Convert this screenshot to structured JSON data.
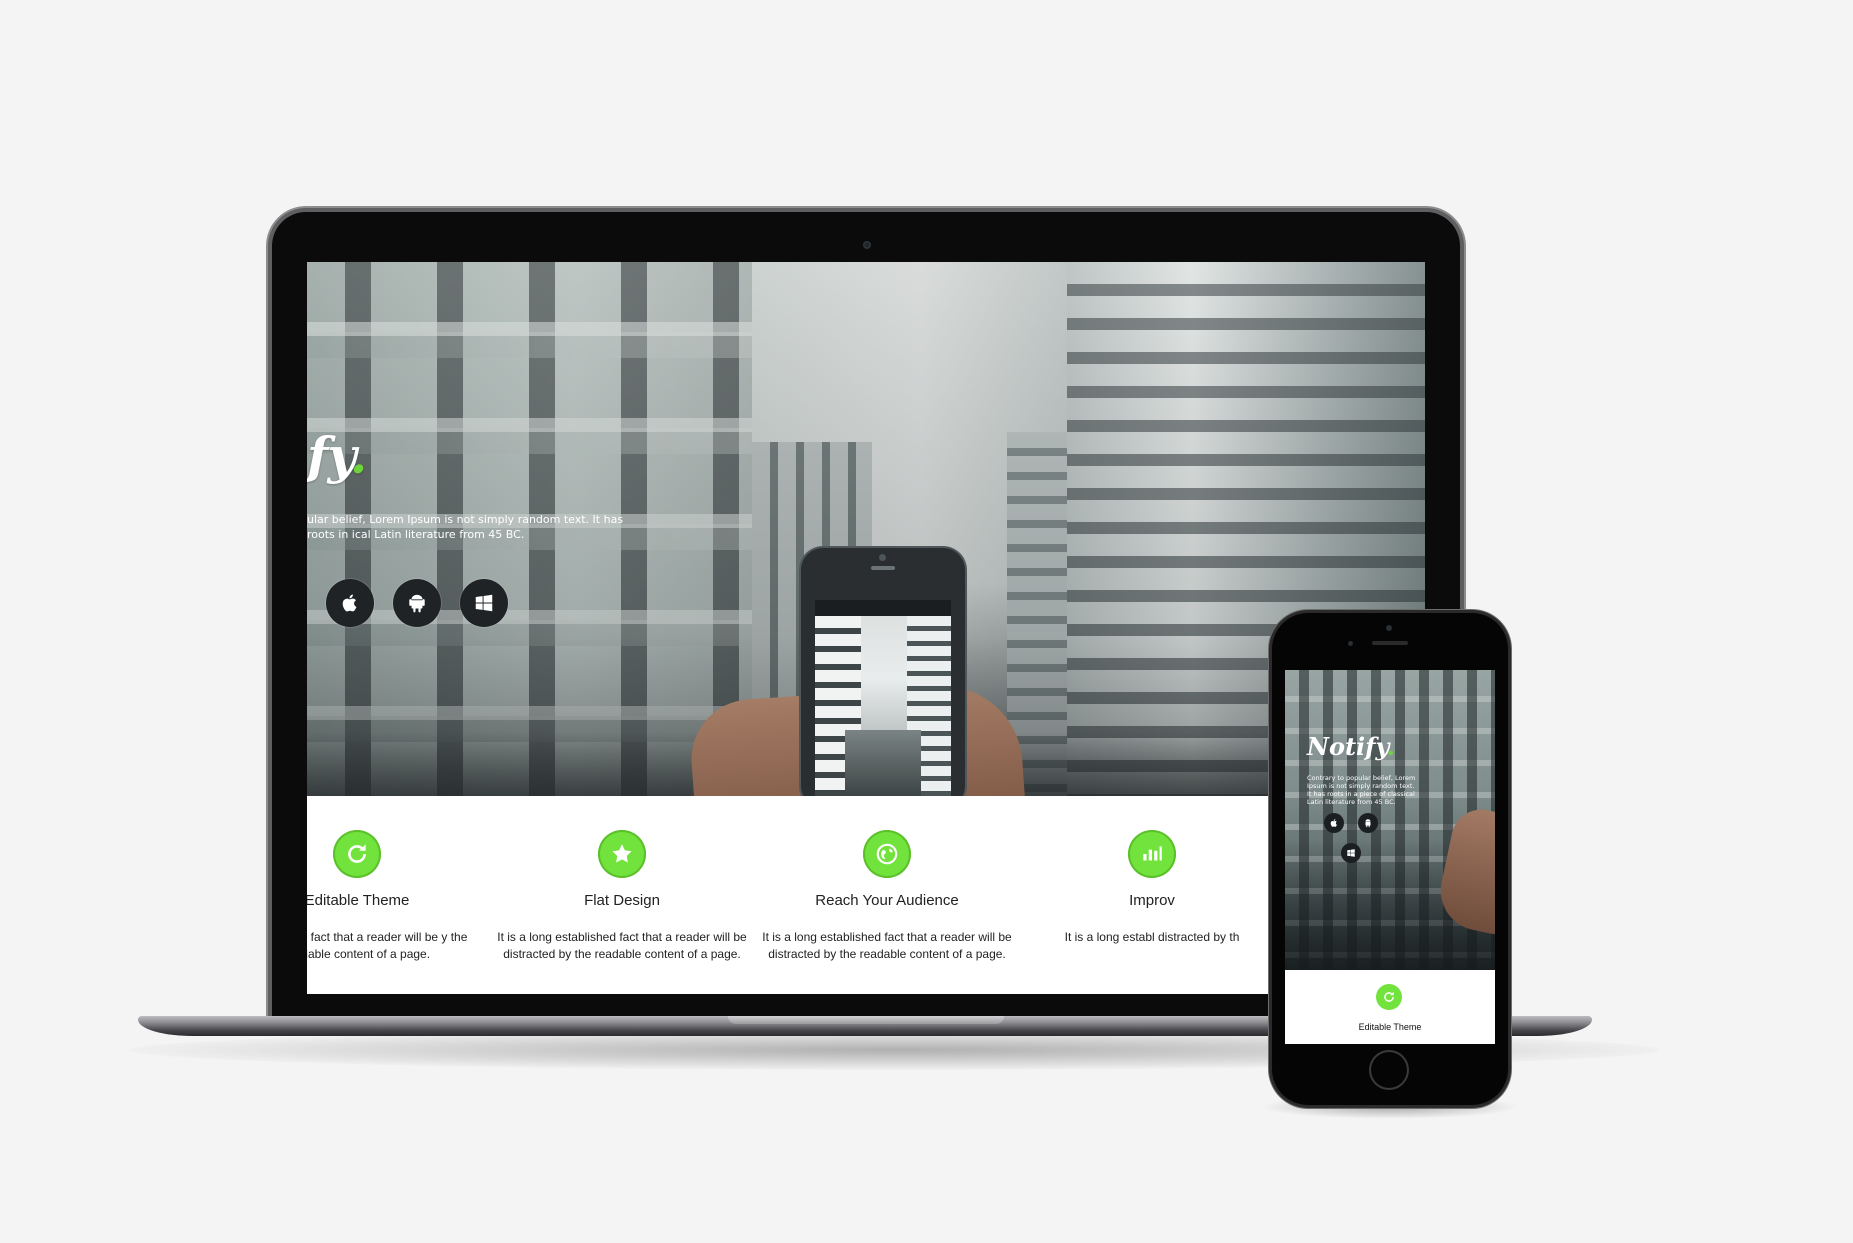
{
  "colors": {
    "accent_green": "#72e23c",
    "page_background": "#f4f4f4",
    "device_frame": "#0b0b0b"
  },
  "laptop": {
    "hero": {
      "brand": "ify",
      "brand_dot": ".",
      "text": "ular belief, Lorem Ipsum is not simply random text. It has roots in ical Latin literature from 45 BC.",
      "store_buttons": [
        {
          "icon": "apple-icon"
        },
        {
          "icon": "android-icon"
        },
        {
          "icon": "windows-icon"
        }
      ]
    },
    "features": [
      {
        "icon": "refresh-icon",
        "title": "Editable Theme",
        "desc": "established fact that a reader will be y the readable content of a page."
      },
      {
        "icon": "star-icon",
        "title": "Flat Design",
        "desc": "It is a long established fact that a reader will be distracted by the readable content of a page."
      },
      {
        "icon": "globe-icon",
        "title": "Reach Your Audience",
        "desc": "It is a long established fact that a reader will be distracted by the readable content of a page."
      },
      {
        "icon": "chart-icon",
        "title": "Improv",
        "desc": "It is a long establ distracted by th"
      }
    ]
  },
  "phone": {
    "hero": {
      "brand": "Notify",
      "brand_dot": ".",
      "text": "Contrary to popular belief, Lorem Ipsum is not simply random text. It has roots in a piece of classical Latin literature from 45 BC.",
      "store_buttons": [
        {
          "icon": "apple-icon"
        },
        {
          "icon": "android-icon"
        },
        {
          "icon": "windows-icon"
        }
      ]
    },
    "feature": {
      "icon": "refresh-icon",
      "title": "Editable Theme"
    }
  }
}
